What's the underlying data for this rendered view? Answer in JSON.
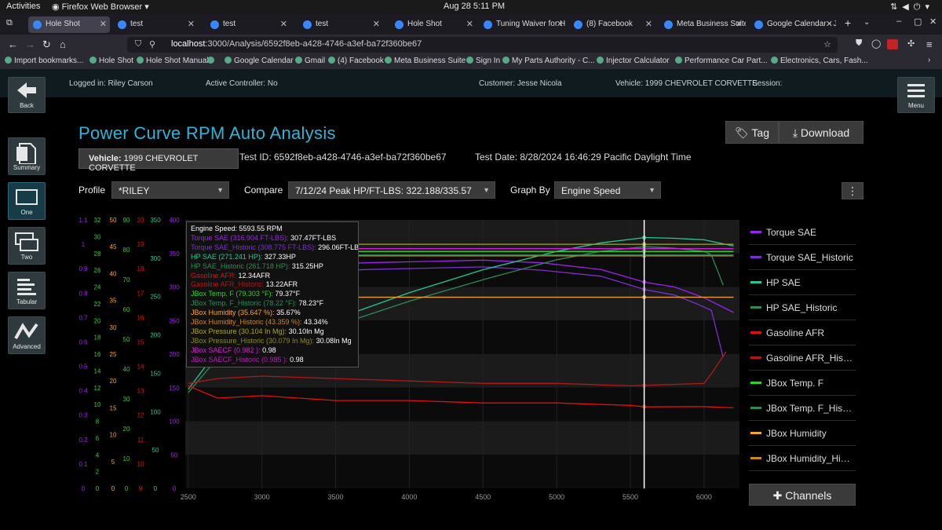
{
  "system_bar": {
    "activities": "Activities",
    "app_name": "Firefox Web Browser",
    "clock": "Aug 28  5:11 PM"
  },
  "browser": {
    "tabs": [
      {
        "label": "Hole Shot",
        "active": true
      },
      {
        "label": "test",
        "active": false
      },
      {
        "label": "test",
        "active": false
      },
      {
        "label": "test",
        "active": false
      },
      {
        "label": "Hole Shot",
        "active": false
      },
      {
        "label": "Tuning Waiver for H",
        "active": false
      },
      {
        "label": "(8) Facebook",
        "active": false
      },
      {
        "label": "Meta Business Suite",
        "active": false
      },
      {
        "label": "Google Calendar - J",
        "active": false
      }
    ],
    "url_host": "localhost",
    "url_path": ":3000/Analysis/6592f8eb-a428-4746-a3ef-ba72f360be67",
    "bookmarks": [
      "Import bookmarks...",
      "Hole Shot",
      "Hole Shot Manual",
      "",
      "Google Calendar",
      "Gmail",
      "(4) Facebook",
      "Meta Business Suite",
      "Sign In",
      "My Parts Authority - C...",
      "Injector Calculator",
      "Performance Car Part...",
      "Electronics, Cars, Fash..."
    ]
  },
  "header": {
    "logged_in": "Logged in: Riley Carson",
    "active_controller": "Active Controller: No",
    "customer": "Customer: Jesse Nicola",
    "vehicle": "Vehicle: 1999 CHEVROLET CORVETTE",
    "session": "Session:",
    "back_label": "Back",
    "menu_label": "Menu"
  },
  "sidebar": [
    {
      "label": "Summary",
      "icon": "document-icon",
      "active": false
    },
    {
      "label": "One",
      "icon": "single-window-icon",
      "active": true
    },
    {
      "label": "Two",
      "icon": "double-window-icon",
      "active": false
    },
    {
      "label": "Tabular",
      "icon": "lines-icon",
      "active": false
    },
    {
      "label": "Advanced",
      "icon": "wave-icon",
      "active": false
    }
  ],
  "page": {
    "title": "Power Curve RPM Auto Analysis",
    "tag_label": "Tag",
    "download_label": "Download",
    "vehicle_label": "Vehicle:",
    "vehicle_value": "1999 CHEVROLET CORVETTE",
    "test_id": "Test ID: 6592f8eb-a428-4746-a3ef-ba72f360be67",
    "test_date": "Test Date: 8/28/2024 16:46:29 Pacific Daylight Time",
    "profile_label": "Profile",
    "profile_value": "*RILEY",
    "compare_label": "Compare",
    "compare_value": "7/12/24 Peak HP/FT-LBS: 322.188/335.57",
    "graph_by_label": "Graph By",
    "graph_by_value": "Engine Speed",
    "channels_label": "Channels"
  },
  "tooltip": {
    "header": "Engine Speed: 5593.55 RPM",
    "rows": [
      {
        "label": "Torque SAE (316.904 FT-LBS):",
        "value": "307.47FT-LBS",
        "color": "#a020f0"
      },
      {
        "label": "Torque SAE_Historic (308.775 FT-LBS):",
        "value": "296.06FT-LBS",
        "color": "#7a30d0"
      },
      {
        "label": "HP SAE (271.241 HP):",
        "value": "327.33HP",
        "color": "#20c997"
      },
      {
        "label": "HP SAE_Historic (261.718 HP):",
        "value": "315.25HP",
        "color": "#2e8b57"
      },
      {
        "label": "Gasoline AFR:",
        "value": "12.34AFR",
        "color": "#e01010"
      },
      {
        "label": "Gasoline AFR_Historic:",
        "value": "13.22AFR",
        "color": "#b01818"
      },
      {
        "label": "JBox Temp. F (79.303 °F):",
        "value": "79.37°F",
        "color": "#32cd32"
      },
      {
        "label": "JBox Temp. F_Historic (78.22 °F):",
        "value": "78.23°F",
        "color": "#2e8b57"
      },
      {
        "label": "JBox Humidity (35.647 %):",
        "value": "35.67%",
        "color": "#f5a623"
      },
      {
        "label": "JBox Humidity_Historic (43.359 %):",
        "value": "43.34%",
        "color": "#c8891a"
      },
      {
        "label": "JBox Pressure (30.104 In Mg):",
        "value": "30.10In Mg",
        "color": "#a8a81a"
      },
      {
        "label": "JBox Pressure_Historic (30.079 In Mg):",
        "value": "30.08In Mg",
        "color": "#8a8a20"
      },
      {
        "label": "JBox SAECF (0.982 ):",
        "value": "0.98",
        "color": "#d020d0"
      },
      {
        "label": "JBox SAECF_Historic (0.985 ):",
        "value": "0.98",
        "color": "#b020b0"
      }
    ]
  },
  "legend": [
    {
      "label": "Torque SAE",
      "color": "#a020f0"
    },
    {
      "label": "Torque SAE_Historic",
      "color": "#7a30d0"
    },
    {
      "label": "HP SAE",
      "color": "#20c997"
    },
    {
      "label": "HP SAE_Historic",
      "color": "#2e8b57"
    },
    {
      "label": "Gasoline AFR",
      "color": "#e01010"
    },
    {
      "label": "Gasoline AFR_Historic",
      "color": "#b01818"
    },
    {
      "label": "JBox Temp. F",
      "color": "#32cd32"
    },
    {
      "label": "JBox Temp. F_Historic",
      "color": "#2e8b57"
    },
    {
      "label": "JBox Humidity",
      "color": "#f5a623"
    },
    {
      "label": "JBox Humidity_Historic",
      "color": "#c8891a"
    }
  ],
  "chart_data": {
    "type": "line",
    "xlabel": "",
    "xlim": [
      2480,
      6240
    ],
    "x_ticks": [
      2500,
      3000,
      3500,
      4000,
      4500,
      5000,
      5500,
      6000
    ],
    "cursor_x": 5593.55,
    "grid": true,
    "y_axes": [
      {
        "color": "#a020f0",
        "ticks": [
          "0",
          "0.1",
          "0.2",
          "0.3",
          "0.4",
          "0.5",
          "0.6",
          "0.7",
          "0.8",
          "0.9",
          "1",
          "1.1"
        ]
      },
      {
        "color": "#32cd32",
        "ticks": [
          "0",
          "2",
          "4",
          "6",
          "8",
          "10",
          "12",
          "14",
          "16",
          "18",
          "20",
          "22",
          "24",
          "26",
          "28",
          "30",
          "32"
        ]
      },
      {
        "color": "#f5a623",
        "ticks": [
          "0",
          "5",
          "10",
          "15",
          "20",
          "25",
          "30",
          "35",
          "40",
          "45",
          "50"
        ]
      },
      {
        "color": "#32cd32",
        "ticks": [
          "0",
          "10",
          "20",
          "30",
          "40",
          "50",
          "60",
          "70",
          "80",
          "90"
        ]
      },
      {
        "color": "#e01010",
        "ticks": [
          "9",
          "10",
          "11",
          "12",
          "13",
          "14",
          "15",
          "16",
          "17",
          "18",
          "19",
          "20"
        ]
      },
      {
        "color": "#20c997",
        "ticks": [
          "0",
          "50",
          "100",
          "150",
          "200",
          "250",
          "300",
          "350"
        ]
      },
      {
        "color": "#a020f0",
        "ticks": [
          "0",
          "50",
          "100",
          "150",
          "200",
          "250",
          "300",
          "350",
          "400"
        ]
      }
    ],
    "series": [
      {
        "name": "Torque SAE",
        "axis": "0-400",
        "x": [
          2500,
          2900,
          3300,
          3700,
          4100,
          4500,
          4900,
          5300,
          5600,
          5800,
          6000,
          6200
        ],
        "y": [
          262,
          318,
          332,
          336,
          338,
          340,
          336,
          326,
          307,
          300,
          284,
          262
        ]
      },
      {
        "name": "Torque SAE_Historic",
        "axis": "0-400",
        "x": [
          2500,
          2900,
          3300,
          3700,
          4100,
          4500,
          4900,
          5300,
          5600,
          5800,
          5950,
          6050,
          6130
        ],
        "y": [
          250,
          305,
          322,
          326,
          328,
          330,
          325,
          316,
          296,
          288,
          275,
          265,
          195
        ]
      },
      {
        "name": "HP SAE",
        "axis": "0-350",
        "x": [
          2500,
          2700,
          3000,
          3500,
          4000,
          4500,
          5000,
          5300,
          5600,
          5800,
          6000,
          6200
        ],
        "y": [
          129,
          180,
          194,
          221,
          255,
          285,
          309,
          320,
          327,
          326,
          324,
          316
        ]
      },
      {
        "name": "HP SAE_Historic",
        "axis": "0-350",
        "x": [
          2500,
          2700,
          3000,
          3500,
          4000,
          4500,
          5000,
          5300,
          5600,
          5800,
          6000,
          6050,
          6130
        ],
        "y": [
          125,
          170,
          184,
          212,
          244,
          272,
          298,
          309,
          315,
          313,
          309,
          304,
          265
        ]
      },
      {
        "name": "Gasoline AFR",
        "axis": "9-20",
        "x": [
          2500,
          2700,
          3000,
          3500,
          4000,
          4500,
          5000,
          5500,
          5600,
          6000,
          6200
        ],
        "y": [
          13.2,
          12.7,
          12.8,
          12.6,
          12.6,
          12.5,
          12.5,
          12.4,
          12.34,
          12.35,
          12.3
        ]
      },
      {
        "name": "Gasoline AFR_Historic",
        "axis": "9-20",
        "x": [
          2500,
          2700,
          3000,
          3500,
          4000,
          4500,
          5000,
          5500,
          5600,
          6000,
          6050,
          6150
        ],
        "y": [
          13.3,
          13.5,
          13.6,
          13.5,
          13.4,
          13.3,
          13.3,
          13.2,
          13.22,
          13.3,
          13.7,
          14.6
        ]
      },
      {
        "name": "JBox Humidity",
        "axis": "0-50",
        "x": [
          2500,
          6200
        ],
        "y": [
          35.6,
          35.6
        ]
      },
      {
        "name": "JBox Humidity_Historic",
        "axis": "0-50",
        "x": [
          2500,
          6200
        ],
        "y": [
          43.3,
          43.3
        ]
      },
      {
        "name": "JBox Pressure",
        "axis": "0-1.1",
        "x": [
          2500,
          6200
        ],
        "y": [
          1.0,
          1.0
        ]
      },
      {
        "name": "JBox Temp. F",
        "axis": "0-90",
        "x": [
          2500,
          6200
        ],
        "y": [
          79.4,
          79.4
        ]
      },
      {
        "name": "JBox Temp. F_Historic",
        "axis": "0-90",
        "x": [
          2500,
          6200
        ],
        "y": [
          78.2,
          78.2
        ]
      },
      {
        "name": "JBox SAECF",
        "axis": "0-1.1",
        "x": [
          2500,
          6200
        ],
        "y": [
          0.982,
          0.982
        ]
      }
    ]
  }
}
